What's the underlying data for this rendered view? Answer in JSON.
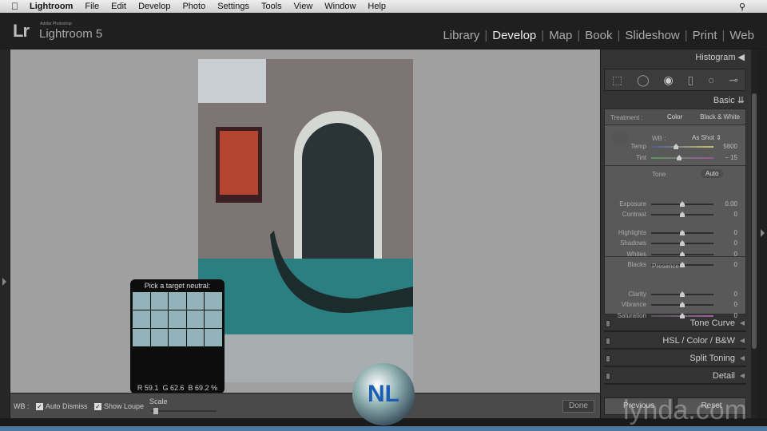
{
  "menubar": {
    "apple": "",
    "items": [
      "Lightroom",
      "File",
      "Edit",
      "Develop",
      "Photo",
      "Settings",
      "Tools",
      "View",
      "Window",
      "Help"
    ]
  },
  "header": {
    "logo": "Lr",
    "adobe": "Adobe Photoshop",
    "product": "Lightroom 5",
    "modules": [
      "Library",
      "Develop",
      "Map",
      "Book",
      "Slideshow",
      "Print",
      "Web"
    ],
    "active_module": "Develop"
  },
  "loupe": {
    "title": "Pick a target neutral:",
    "r_label": "R",
    "r": "59.1",
    "g_label": "G",
    "g": "62.6",
    "b_label": "B",
    "b": "69.2",
    "unit": "%"
  },
  "toolbar": {
    "wb": "WB :",
    "auto_dismiss": "Auto Dismiss",
    "auto_dismiss_checked": true,
    "show_loupe": "Show Loupe",
    "show_loupe_checked": true,
    "scale": "Scale",
    "done": "Done"
  },
  "right_panel": {
    "histogram": "Histogram",
    "basic": "Basic",
    "treatment_label": "Treatment :",
    "treatment_color": "Color",
    "treatment_bw": "Black & White",
    "wb_label": "WB :",
    "wb_value": "As Shot",
    "temp": {
      "label": "Temp",
      "value": "5800",
      "pos": 0.4
    },
    "tint": {
      "label": "Tint",
      "value": "− 15",
      "pos": 0.45
    },
    "tone": "Tone",
    "auto": "Auto",
    "exposure": {
      "label": "Exposure",
      "value": "0.00",
      "pos": 0.5
    },
    "contrast": {
      "label": "Contrast",
      "value": "0",
      "pos": 0.5
    },
    "highlights": {
      "label": "Highlights",
      "value": "0",
      "pos": 0.5
    },
    "shadows": {
      "label": "Shadows",
      "value": "0",
      "pos": 0.5
    },
    "whites": {
      "label": "Whites",
      "value": "0",
      "pos": 0.5
    },
    "blacks": {
      "label": "Blacks",
      "value": "0",
      "pos": 0.5
    },
    "presence": "Presence",
    "clarity": {
      "label": "Clarity",
      "value": "0",
      "pos": 0.5
    },
    "vibrance": {
      "label": "Vibrance",
      "value": "0",
      "pos": 0.5
    },
    "saturation": {
      "label": "Saturation",
      "value": "0",
      "pos": 0.5
    },
    "tone_curve": "Tone Curve",
    "hsl": "HSL / Color / B&W",
    "split_toning": "Split Toning",
    "detail": "Detail",
    "previous": "Previous",
    "reset": "Reset"
  },
  "watermark": {
    "text": "lynda.com",
    "logo": "NL"
  }
}
